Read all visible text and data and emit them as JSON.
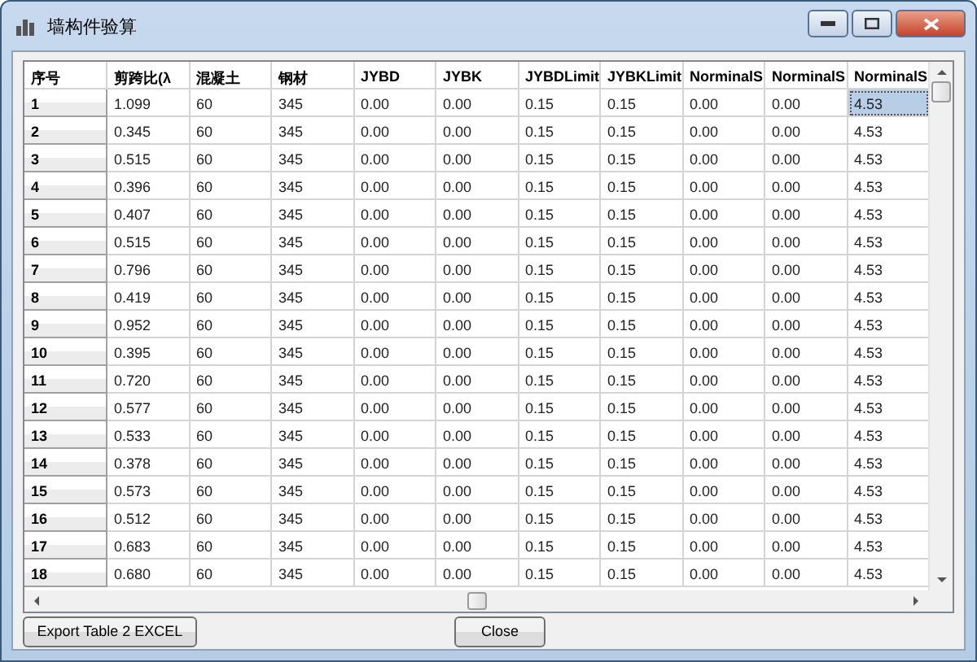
{
  "window": {
    "title": "墙构件验算"
  },
  "table": {
    "corner": "序号",
    "columns": [
      "剪跨比(λ",
      "混凝土",
      "钢材",
      "JYBD",
      "JYBK",
      "JYBDLimit",
      "JYBKLimit",
      "NorminalS",
      "NorminalS",
      "NorminalS"
    ],
    "rows": [
      {
        "header": "1",
        "cells": [
          {
            "text": "1.099",
            "selected": false
          },
          {
            "text": "60",
            "selected": false
          },
          {
            "text": "345",
            "selected": false
          },
          {
            "text": "0.00",
            "selected": false
          },
          {
            "text": "0.00",
            "selected": false
          },
          {
            "text": "0.15",
            "selected": false
          },
          {
            "text": "0.15",
            "selected": false
          },
          {
            "text": "0.00",
            "selected": false
          },
          {
            "text": "0.00",
            "selected": false
          },
          {
            "text": "4.53",
            "selected": true
          }
        ]
      },
      {
        "header": "2",
        "cells": [
          {
            "text": "0.345",
            "selected": false
          },
          {
            "text": "60",
            "selected": false
          },
          {
            "text": "345",
            "selected": false
          },
          {
            "text": "0.00",
            "selected": false
          },
          {
            "text": "0.00",
            "selected": false
          },
          {
            "text": "0.15",
            "selected": false
          },
          {
            "text": "0.15",
            "selected": false
          },
          {
            "text": "0.00",
            "selected": false
          },
          {
            "text": "0.00",
            "selected": false
          },
          {
            "text": "4.53",
            "selected": false
          }
        ]
      },
      {
        "header": "3",
        "cells": [
          {
            "text": "0.515",
            "selected": false
          },
          {
            "text": "60",
            "selected": false
          },
          {
            "text": "345",
            "selected": false
          },
          {
            "text": "0.00",
            "selected": false
          },
          {
            "text": "0.00",
            "selected": false
          },
          {
            "text": "0.15",
            "selected": false
          },
          {
            "text": "0.15",
            "selected": false
          },
          {
            "text": "0.00",
            "selected": false
          },
          {
            "text": "0.00",
            "selected": false
          },
          {
            "text": "4.53",
            "selected": false
          }
        ]
      },
      {
        "header": "4",
        "cells": [
          {
            "text": "0.396",
            "selected": false
          },
          {
            "text": "60",
            "selected": false
          },
          {
            "text": "345",
            "selected": false
          },
          {
            "text": "0.00",
            "selected": false
          },
          {
            "text": "0.00",
            "selected": false
          },
          {
            "text": "0.15",
            "selected": false
          },
          {
            "text": "0.15",
            "selected": false
          },
          {
            "text": "0.00",
            "selected": false
          },
          {
            "text": "0.00",
            "selected": false
          },
          {
            "text": "4.53",
            "selected": false
          }
        ]
      },
      {
        "header": "5",
        "cells": [
          {
            "text": "0.407",
            "selected": false
          },
          {
            "text": "60",
            "selected": false
          },
          {
            "text": "345",
            "selected": false
          },
          {
            "text": "0.00",
            "selected": false
          },
          {
            "text": "0.00",
            "selected": false
          },
          {
            "text": "0.15",
            "selected": false
          },
          {
            "text": "0.15",
            "selected": false
          },
          {
            "text": "0.00",
            "selected": false
          },
          {
            "text": "0.00",
            "selected": false
          },
          {
            "text": "4.53",
            "selected": false
          }
        ]
      },
      {
        "header": "6",
        "cells": [
          {
            "text": "0.515",
            "selected": false
          },
          {
            "text": "60",
            "selected": false
          },
          {
            "text": "345",
            "selected": false
          },
          {
            "text": "0.00",
            "selected": false
          },
          {
            "text": "0.00",
            "selected": false
          },
          {
            "text": "0.15",
            "selected": false
          },
          {
            "text": "0.15",
            "selected": false
          },
          {
            "text": "0.00",
            "selected": false
          },
          {
            "text": "0.00",
            "selected": false
          },
          {
            "text": "4.53",
            "selected": false
          }
        ]
      },
      {
        "header": "7",
        "cells": [
          {
            "text": "0.796",
            "selected": false
          },
          {
            "text": "60",
            "selected": false
          },
          {
            "text": "345",
            "selected": false
          },
          {
            "text": "0.00",
            "selected": false
          },
          {
            "text": "0.00",
            "selected": false
          },
          {
            "text": "0.15",
            "selected": false
          },
          {
            "text": "0.15",
            "selected": false
          },
          {
            "text": "0.00",
            "selected": false
          },
          {
            "text": "0.00",
            "selected": false
          },
          {
            "text": "4.53",
            "selected": false
          }
        ]
      },
      {
        "header": "8",
        "cells": [
          {
            "text": "0.419",
            "selected": false
          },
          {
            "text": "60",
            "selected": false
          },
          {
            "text": "345",
            "selected": false
          },
          {
            "text": "0.00",
            "selected": false
          },
          {
            "text": "0.00",
            "selected": false
          },
          {
            "text": "0.15",
            "selected": false
          },
          {
            "text": "0.15",
            "selected": false
          },
          {
            "text": "0.00",
            "selected": false
          },
          {
            "text": "0.00",
            "selected": false
          },
          {
            "text": "4.53",
            "selected": false
          }
        ]
      },
      {
        "header": "9",
        "cells": [
          {
            "text": "0.952",
            "selected": false
          },
          {
            "text": "60",
            "selected": false
          },
          {
            "text": "345",
            "selected": false
          },
          {
            "text": "0.00",
            "selected": false
          },
          {
            "text": "0.00",
            "selected": false
          },
          {
            "text": "0.15",
            "selected": false
          },
          {
            "text": "0.15",
            "selected": false
          },
          {
            "text": "0.00",
            "selected": false
          },
          {
            "text": "0.00",
            "selected": false
          },
          {
            "text": "4.53",
            "selected": false
          }
        ]
      },
      {
        "header": "10",
        "cells": [
          {
            "text": "0.395",
            "selected": false
          },
          {
            "text": "60",
            "selected": false
          },
          {
            "text": "345",
            "selected": false
          },
          {
            "text": "0.00",
            "selected": false
          },
          {
            "text": "0.00",
            "selected": false
          },
          {
            "text": "0.15",
            "selected": false
          },
          {
            "text": "0.15",
            "selected": false
          },
          {
            "text": "0.00",
            "selected": false
          },
          {
            "text": "0.00",
            "selected": false
          },
          {
            "text": "4.53",
            "selected": false
          }
        ]
      },
      {
        "header": "11",
        "cells": [
          {
            "text": "0.720",
            "selected": false
          },
          {
            "text": "60",
            "selected": false
          },
          {
            "text": "345",
            "selected": false
          },
          {
            "text": "0.00",
            "selected": false
          },
          {
            "text": "0.00",
            "selected": false
          },
          {
            "text": "0.15",
            "selected": false
          },
          {
            "text": "0.15",
            "selected": false
          },
          {
            "text": "0.00",
            "selected": false
          },
          {
            "text": "0.00",
            "selected": false
          },
          {
            "text": "4.53",
            "selected": false
          }
        ]
      },
      {
        "header": "12",
        "cells": [
          {
            "text": "0.577",
            "selected": false
          },
          {
            "text": "60",
            "selected": false
          },
          {
            "text": "345",
            "selected": false
          },
          {
            "text": "0.00",
            "selected": false
          },
          {
            "text": "0.00",
            "selected": false
          },
          {
            "text": "0.15",
            "selected": false
          },
          {
            "text": "0.15",
            "selected": false
          },
          {
            "text": "0.00",
            "selected": false
          },
          {
            "text": "0.00",
            "selected": false
          },
          {
            "text": "4.53",
            "selected": false
          }
        ]
      },
      {
        "header": "13",
        "cells": [
          {
            "text": "0.533",
            "selected": false
          },
          {
            "text": "60",
            "selected": false
          },
          {
            "text": "345",
            "selected": false
          },
          {
            "text": "0.00",
            "selected": false
          },
          {
            "text": "0.00",
            "selected": false
          },
          {
            "text": "0.15",
            "selected": false
          },
          {
            "text": "0.15",
            "selected": false
          },
          {
            "text": "0.00",
            "selected": false
          },
          {
            "text": "0.00",
            "selected": false
          },
          {
            "text": "4.53",
            "selected": false
          }
        ]
      },
      {
        "header": "14",
        "cells": [
          {
            "text": "0.378",
            "selected": false
          },
          {
            "text": "60",
            "selected": false
          },
          {
            "text": "345",
            "selected": false
          },
          {
            "text": "0.00",
            "selected": false
          },
          {
            "text": "0.00",
            "selected": false
          },
          {
            "text": "0.15",
            "selected": false
          },
          {
            "text": "0.15",
            "selected": false
          },
          {
            "text": "0.00",
            "selected": false
          },
          {
            "text": "0.00",
            "selected": false
          },
          {
            "text": "4.53",
            "selected": false
          }
        ]
      },
      {
        "header": "15",
        "cells": [
          {
            "text": "0.573",
            "selected": false
          },
          {
            "text": "60",
            "selected": false
          },
          {
            "text": "345",
            "selected": false
          },
          {
            "text": "0.00",
            "selected": false
          },
          {
            "text": "0.00",
            "selected": false
          },
          {
            "text": "0.15",
            "selected": false
          },
          {
            "text": "0.15",
            "selected": false
          },
          {
            "text": "0.00",
            "selected": false
          },
          {
            "text": "0.00",
            "selected": false
          },
          {
            "text": "4.53",
            "selected": false
          }
        ]
      },
      {
        "header": "16",
        "cells": [
          {
            "text": "0.512",
            "selected": false
          },
          {
            "text": "60",
            "selected": false
          },
          {
            "text": "345",
            "selected": false
          },
          {
            "text": "0.00",
            "selected": false
          },
          {
            "text": "0.00",
            "selected": false
          },
          {
            "text": "0.15",
            "selected": false
          },
          {
            "text": "0.15",
            "selected": false
          },
          {
            "text": "0.00",
            "selected": false
          },
          {
            "text": "0.00",
            "selected": false
          },
          {
            "text": "4.53",
            "selected": false
          }
        ]
      },
      {
        "header": "17",
        "cells": [
          {
            "text": "0.683",
            "selected": false
          },
          {
            "text": "60",
            "selected": false
          },
          {
            "text": "345",
            "selected": false
          },
          {
            "text": "0.00",
            "selected": false
          },
          {
            "text": "0.00",
            "selected": false
          },
          {
            "text": "0.15",
            "selected": false
          },
          {
            "text": "0.15",
            "selected": false
          },
          {
            "text": "0.00",
            "selected": false
          },
          {
            "text": "0.00",
            "selected": false
          },
          {
            "text": "4.53",
            "selected": false
          }
        ]
      },
      {
        "header": "18",
        "cells": [
          {
            "text": "0.680",
            "selected": false
          },
          {
            "text": "60",
            "selected": false
          },
          {
            "text": "345",
            "selected": false
          },
          {
            "text": "0.00",
            "selected": false
          },
          {
            "text": "0.00",
            "selected": false
          },
          {
            "text": "0.15",
            "selected": false
          },
          {
            "text": "0.15",
            "selected": false
          },
          {
            "text": "0.00",
            "selected": false
          },
          {
            "text": "0.00",
            "selected": false
          },
          {
            "text": "4.53",
            "selected": false
          }
        ]
      }
    ]
  },
  "buttons": [
    "Export Table 2 EXCEL",
    "Close"
  ]
}
